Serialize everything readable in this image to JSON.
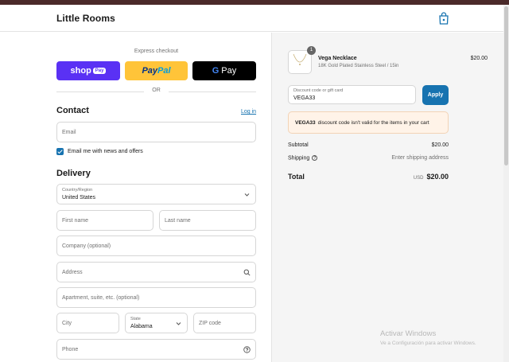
{
  "header": {
    "brand": "Little Rooms",
    "cart_icon": "shopping-bag-icon"
  },
  "express": {
    "title": "Express checkout",
    "shop_label": "shop",
    "shop_pay_label": "Pay",
    "paypal_part1": "Pay",
    "paypal_part2": "Pal",
    "gpay_g": "G",
    "gpay_label": "Pay",
    "or_label": "OR"
  },
  "contact": {
    "heading": "Contact",
    "login_label": "Log in",
    "email_placeholder": "Email",
    "newsletter_label": "Email me with news and offers",
    "newsletter_checked": true
  },
  "delivery": {
    "heading": "Delivery",
    "country_label": "Country/Region",
    "country_value": "United States",
    "first_name_placeholder": "First name",
    "last_name_placeholder": "Last name",
    "company_placeholder": "Company (optional)",
    "address_placeholder": "Address",
    "apartment_placeholder": "Apartment, suite, etc. (optional)",
    "city_placeholder": "City",
    "state_label": "State",
    "state_value": "Alabama",
    "zip_placeholder": "ZIP code",
    "phone_placeholder": "Phone"
  },
  "order": {
    "item": {
      "quantity": "1",
      "name": "Vega Necklace",
      "variant": "18K Gold Plated Stainless Steel / 15in",
      "price": "$20.00"
    },
    "discount": {
      "label": "Discount code or gift card",
      "value": "VEGA33",
      "apply_label": "Apply"
    },
    "error": {
      "code": "VEGA33",
      "message": "discount code isn't valid for the items in your cart"
    },
    "subtotal_label": "Subtotal",
    "subtotal_value": "$20.00",
    "shipping_label": "Shipping",
    "shipping_value": "Enter shipping address",
    "total_label": "Total",
    "total_currency": "USD",
    "total_value": "$20.00"
  },
  "watermark": {
    "line1": "Activar Windows",
    "line2": "Ve a Configuración para activar Windows."
  },
  "colors": {
    "accent": "#1773b0",
    "shop_pay": "#5a31f4",
    "paypal": "#ffc439",
    "gpay": "#000000",
    "error_bg": "#fff3e8"
  }
}
